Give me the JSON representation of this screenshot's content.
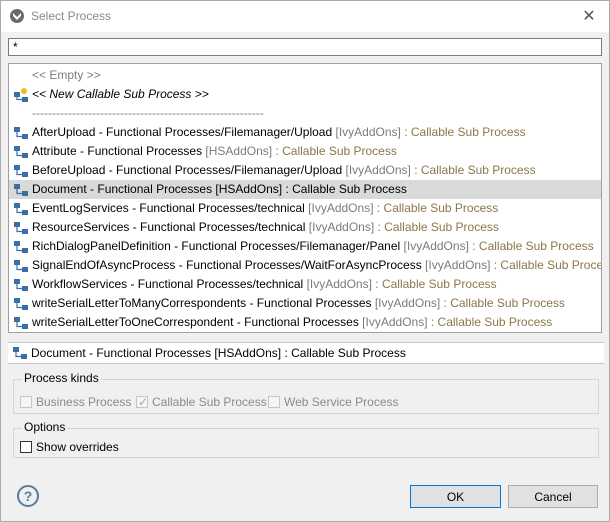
{
  "window": {
    "title": "Select Process",
    "icon": "axon-ivy-logo-icon",
    "close_icon": "close-icon",
    "close_glyph": "✕"
  },
  "filter": {
    "value": "*"
  },
  "list": {
    "items": [
      {
        "name": "<< Empty >>",
        "style": "empty"
      },
      {
        "name": "<< New Callable Sub Process >>",
        "style": "new",
        "icon": "new-subprocess-icon"
      },
      {
        "name": "----------------------------------------------------------",
        "style": "separator"
      },
      {
        "name": "AfterUpload",
        "path": " - Functional Processes/Filemanager/Upload",
        "project": " [IvyAddOns]",
        "kind": " : Callable Sub Process",
        "icon": "callable-subprocess-icon"
      },
      {
        "name": "Attribute",
        "path": " - Functional Processes",
        "project": " [HSAddOns]",
        "kind": " : Callable Sub Process",
        "icon": "callable-subprocess-icon"
      },
      {
        "name": "BeforeUpload",
        "path": " - Functional Processes/Filemanager/Upload",
        "project": " [IvyAddOns]",
        "kind": " : Callable Sub Process",
        "icon": "callable-subprocess-icon"
      },
      {
        "name": "Document",
        "path": " - Functional Processes",
        "project": " [HSAddOns]",
        "kind": " : Callable Sub Process",
        "icon": "callable-subprocess-icon",
        "selected": true
      },
      {
        "name": "EventLogServices",
        "path": " - Functional Processes/technical",
        "project": " [IvyAddOns]",
        "kind": " : Callable Sub Process",
        "icon": "callable-subprocess-icon"
      },
      {
        "name": "ResourceServices",
        "path": " - Functional Processes/technical",
        "project": " [IvyAddOns]",
        "kind": " : Callable Sub Process",
        "icon": "callable-subprocess-icon"
      },
      {
        "name": "RichDialogPanelDefinition",
        "path": " - Functional Processes/Filemanager/Panel",
        "project": " [IvyAddOns]",
        "kind": " : Callable Sub Process",
        "icon": "callable-subprocess-icon"
      },
      {
        "name": "SignalEndOfAsyncProcess",
        "path": " - Functional Processes/WaitForAsyncProcess",
        "project": " [IvyAddOns]",
        "kind": " : Callable Sub Process",
        "icon": "callable-subprocess-icon"
      },
      {
        "name": "WorkflowServices",
        "path": " - Functional Processes/technical",
        "project": " [IvyAddOns]",
        "kind": " : Callable Sub Process",
        "icon": "callable-subprocess-icon"
      },
      {
        "name": "writeSerialLetterToManyCorrespondents",
        "path": " - Functional Processes",
        "project": " [IvyAddOns]",
        "kind": " : Callable Sub Process",
        "icon": "callable-subprocess-icon"
      },
      {
        "name": "writeSerialLetterToOneCorrespondent",
        "path": " - Functional Processes",
        "project": " [IvyAddOns]",
        "kind": " : Callable Sub Process",
        "icon": "callable-subprocess-icon"
      }
    ]
  },
  "status": {
    "text": "Document - Functional Processes [HSAddOns] : Callable Sub Process",
    "icon": "callable-subprocess-icon"
  },
  "process_kinds": {
    "title": "Process kinds",
    "business": "Business Process",
    "callable": "Callable Sub Process",
    "webservice": "Web Service Process"
  },
  "options": {
    "title": "Options",
    "show_overrides": "Show overrides"
  },
  "buttons": {
    "help_icon": "help-icon",
    "help_glyph": "?",
    "ok": "OK",
    "cancel": "Cancel"
  },
  "colors": {
    "project": "#7b7b7b",
    "kind": "#8b7749",
    "selected_row": "#d9d9d9",
    "ok_border": "#0078d7"
  }
}
